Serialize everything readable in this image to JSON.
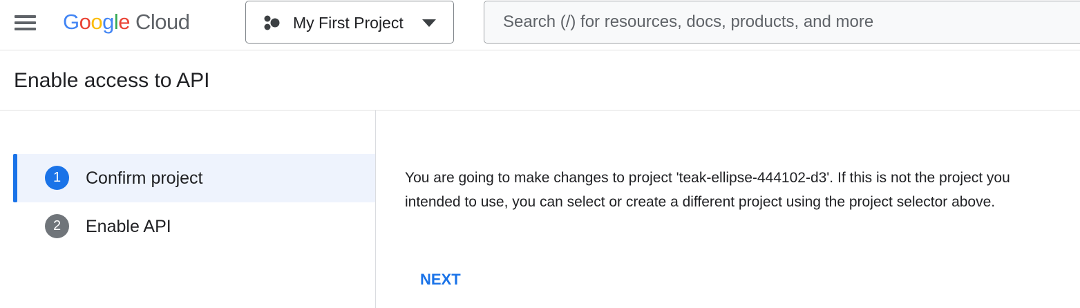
{
  "topbar": {
    "menu_icon": "hamburger-menu-icon",
    "logo": {
      "google": [
        "G",
        "o",
        "o",
        "g",
        "l",
        "e"
      ],
      "google_colors": [
        "#4285F4",
        "#EA4335",
        "#FBBC05",
        "#4285F4",
        "#34A853",
        "#EA4335"
      ],
      "product": "Cloud"
    },
    "project_picker": {
      "icon": "project-hexagon-icon",
      "label": "My First Project",
      "caret_icon": "caret-down-icon"
    },
    "search": {
      "placeholder": "Search (/) for resources, docs, products, and more",
      "value": ""
    }
  },
  "page": {
    "title": "Enable access to API"
  },
  "stepper": {
    "steps": [
      {
        "number": "1",
        "label": "Confirm project",
        "active": true
      },
      {
        "number": "2",
        "label": "Enable API",
        "active": false
      }
    ],
    "active_color": "#1a73e8",
    "active_bg": "#eef3fd"
  },
  "content": {
    "message": "You are going to make changes to project 'teak-ellipse-444102-d3'. If this is not the project you intended to use, you can select or create a different project using the project selector above.",
    "next_label": "NEXT"
  }
}
